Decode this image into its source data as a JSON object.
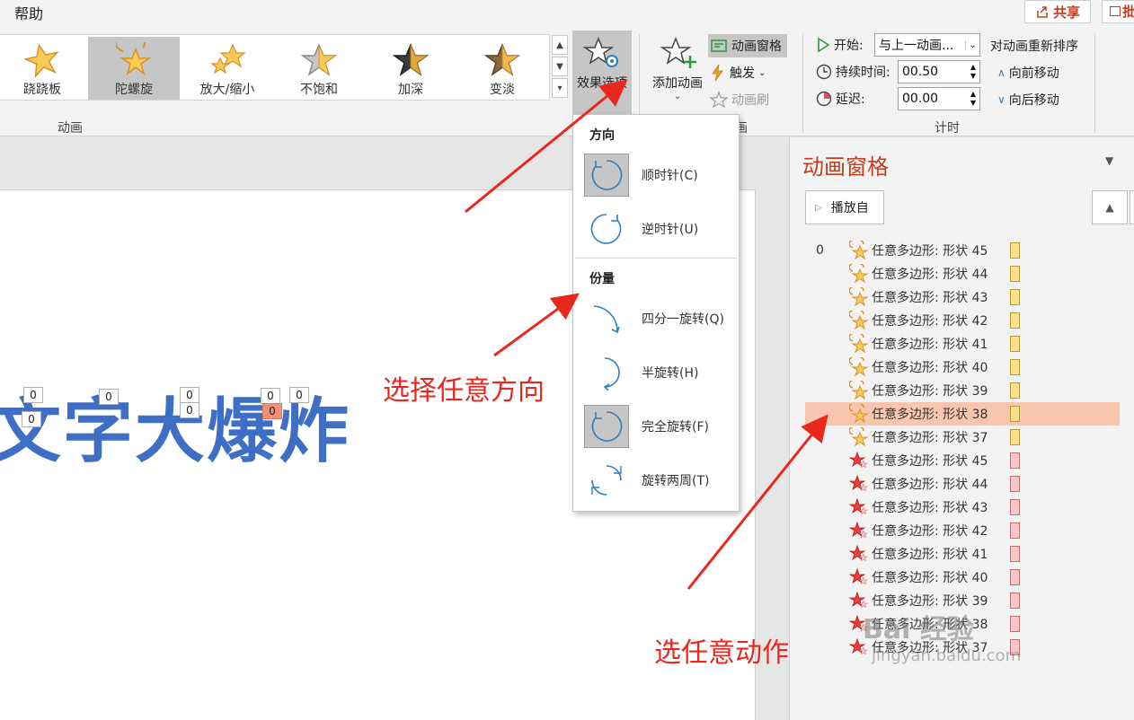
{
  "menu": {
    "help": "帮助"
  },
  "top": {
    "share": "共享",
    "comment": "批"
  },
  "gallery": {
    "items": [
      {
        "label": "跷跷板"
      },
      {
        "label": "陀螺旋"
      },
      {
        "label": "放大/缩小"
      },
      {
        "label": "不饱和"
      },
      {
        "label": "加深"
      },
      {
        "label": "变淡"
      }
    ],
    "group_label": "动画"
  },
  "effect_options": {
    "label": "效果选项"
  },
  "advanced": {
    "add_animation": "添加动画",
    "animation_pane": "动画窗格",
    "trigger": "触发",
    "animation_painter": "动画刷",
    "group_label_partial": "画"
  },
  "timing": {
    "start_label": "开始:",
    "start_value": "与上一动画...",
    "duration_label": "持续时间:",
    "duration_value": "00.50",
    "delay_label": "延迟:",
    "delay_value": "00.00",
    "reorder_label": "对动画重新排序",
    "move_earlier": "向前移动",
    "move_later": "向后移动",
    "group_label": "计时"
  },
  "slide": {
    "title": "文字大爆炸",
    "tags": [
      "0",
      "0",
      "0",
      "0",
      "0",
      "0",
      "0",
      "0",
      "0"
    ]
  },
  "dropdown": {
    "direction_header": "方向",
    "amount_header": "份量",
    "items": [
      {
        "label": "顺时针(C)"
      },
      {
        "label": "逆时针(U)"
      },
      {
        "label": "四分一旋转(Q)"
      },
      {
        "label": "半旋转(H)"
      },
      {
        "label": "完全旋转(F)"
      },
      {
        "label": "旋转两周(T)"
      }
    ]
  },
  "pane": {
    "title": "动画窗格",
    "play_from": "播放自",
    "rows": [
      {
        "num": "0",
        "label": "任意多边形: 形状 45",
        "kind": "spin"
      },
      {
        "num": "",
        "label": "任意多边形: 形状 44",
        "kind": "spin"
      },
      {
        "num": "",
        "label": "任意多边形: 形状 43",
        "kind": "spin"
      },
      {
        "num": "",
        "label": "任意多边形: 形状 42",
        "kind": "spin"
      },
      {
        "num": "",
        "label": "任意多边形: 形状 41",
        "kind": "spin"
      },
      {
        "num": "",
        "label": "任意多边形: 形状 40",
        "kind": "spin"
      },
      {
        "num": "",
        "label": "任意多边形: 形状 39",
        "kind": "spin"
      },
      {
        "num": "",
        "label": "任意多边形: 形状 38",
        "kind": "spin",
        "selected": true
      },
      {
        "num": "",
        "label": "任意多边形: 形状 37",
        "kind": "spin"
      },
      {
        "num": "",
        "label": "任意多边形: 形状 45",
        "kind": "exit"
      },
      {
        "num": "",
        "label": "任意多边形: 形状 44",
        "kind": "exit"
      },
      {
        "num": "",
        "label": "任意多边形: 形状 43",
        "kind": "exit"
      },
      {
        "num": "",
        "label": "任意多边形: 形状 42",
        "kind": "exit"
      },
      {
        "num": "",
        "label": "任意多边形: 形状 41",
        "kind": "exit"
      },
      {
        "num": "",
        "label": "任意多边形: 形状 40",
        "kind": "exit"
      },
      {
        "num": "",
        "label": "任意多边形: 形状 39",
        "kind": "exit"
      },
      {
        "num": "",
        "label": "任意多边形: 形状 38",
        "kind": "exit"
      },
      {
        "num": "",
        "label": "任意多边形: 形状 37",
        "kind": "exit"
      }
    ]
  },
  "annotations": {
    "choose_direction": "选择任意方向",
    "choose_action": "选任意动作"
  },
  "watermark": {
    "text": "Bai 经验",
    "url": "jingyan.baidu.com"
  },
  "colors": {
    "accent": "#c43e1c",
    "annotation_red": "#e8281e",
    "slide_text_blue": "#3f6fc4",
    "spin_bar": "#fbe08a",
    "exit_bar": "#f7c7c7",
    "selected_row": "#f8c6ae"
  }
}
